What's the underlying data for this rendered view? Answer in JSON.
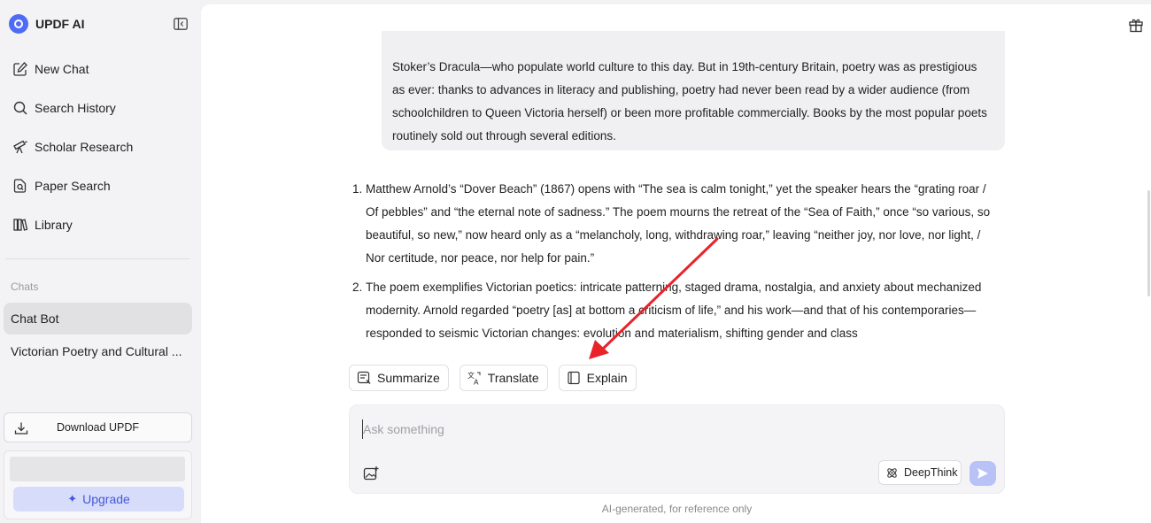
{
  "app": {
    "name": "UPDF AI"
  },
  "sidebar": {
    "nav": [
      {
        "label": "New Chat",
        "icon": "edit-icon"
      },
      {
        "label": "Search History",
        "icon": "search-icon"
      },
      {
        "label": "Scholar Research",
        "icon": "telescope-icon"
      },
      {
        "label": "Paper Search",
        "icon": "document-search-icon"
      },
      {
        "label": "Library",
        "icon": "library-icon"
      }
    ],
    "chats_label": "Chats",
    "chats": [
      {
        "label": "Chat Bot",
        "active": true
      },
      {
        "label": "Victorian Poetry and Cultural ...",
        "active": false
      }
    ],
    "download_label": "Download UPDF",
    "upgrade_label": "Upgrade"
  },
  "conversation": {
    "user_message": "Stoker’s Dracula—who populate world culture to this day. But in 19th-century Britain, poetry was as prestigious as ever: thanks to advances in literacy and publishing, poetry had never been read by a wider audience (from schoolchildren to Queen Victoria herself) or been more profitable commercially. Books by the most popular poets routinely sold out through several editions.",
    "answer_items": [
      "Matthew Arnold’s “Dover Beach” (1867) opens with “The sea is calm tonight,” yet the speaker hears the “grating roar / Of pebbles” and “the eternal note of sadness.” The poem mourns the retreat of the “Sea of Faith,” once “so various, so beautiful, so new,” now heard only as a “melancholy, long, withdrawing roar,” leaving “neither joy, nor love, nor light, / Nor certitude, nor peace, nor help for pain.”",
      "The poem exemplifies Victorian poetics: intricate patterning, staged drama, nostalgia, and anxiety about mechanized modernity. Arnold regarded “poetry [as] at bottom a criticism of life,” and his work—and that of his contemporaries—responded to seismic Victorian changes: evolution and materialism, shifting gender and class"
    ]
  },
  "actions": [
    {
      "label": "Summarize",
      "icon": "summarize-icon"
    },
    {
      "label": "Translate",
      "icon": "translate-icon"
    },
    {
      "label": "Explain",
      "icon": "book-icon"
    }
  ],
  "input": {
    "placeholder": "Ask something",
    "value": ""
  },
  "deepthink_label": "DeepThink",
  "disclaimer": "AI-generated, for reference only",
  "colors": {
    "accent": "#4f6bf5",
    "annotation_arrow": "#e8232a",
    "send_button": "#b9c2f7"
  }
}
